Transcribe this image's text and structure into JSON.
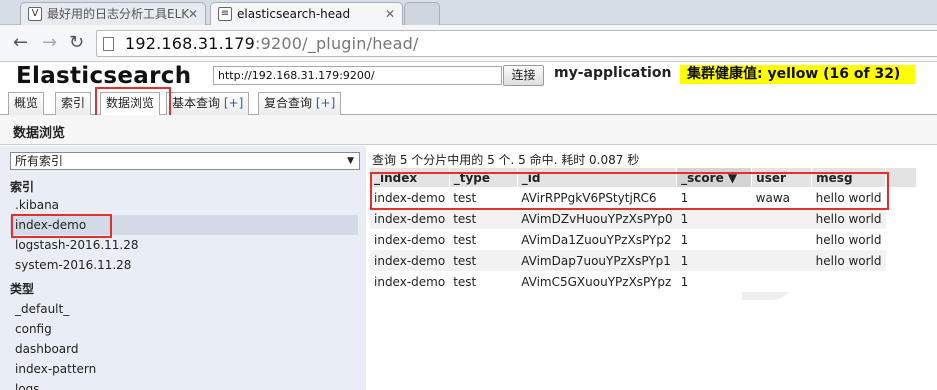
{
  "browser": {
    "tabs": [
      {
        "title": "最好用的日志分析工具ELK"
      },
      {
        "title": "elasticsearch-head"
      }
    ],
    "url_host": "192.168.31.179",
    "url_rest": ":9200/_plugin/head/"
  },
  "app": {
    "title": "Elasticsearch",
    "connect_url": "http://192.168.31.179:9200/",
    "connect_label": "连接",
    "cluster_name": "my-application",
    "health": "集群健康值: yellow (16 of 32)"
  },
  "tabs": {
    "overview": "概览",
    "indices": "索引",
    "browser": "数据浏览",
    "basic_query": "基本查询",
    "complex_query": "复合查询",
    "plus": "[+]"
  },
  "page": {
    "heading": "数据浏览"
  },
  "sidebar": {
    "select_value": "所有索引",
    "indices_label": "索引",
    "indices": [
      ".kibana",
      "index-demo",
      "logstash-2016.11.28",
      "system-2016.11.28"
    ],
    "types_label": "类型",
    "types": [
      "_default_",
      "config",
      "dashboard",
      "index-pattern",
      "logs"
    ]
  },
  "results": {
    "summary": "查询 5 个分片中用的 5 个. 5 命中. 耗时 0.087 秒",
    "columns": [
      "_index",
      "_type",
      "_id",
      "_score ▼",
      "user",
      "mesg"
    ],
    "rows": [
      [
        "index-demo",
        "test",
        "AVirRPPgkV6PStytjRC6",
        "1",
        "wawa",
        "hello world"
      ],
      [
        "index-demo",
        "test",
        "AVimDZvHuouYPzXsPYp0",
        "1",
        "",
        "hello world"
      ],
      [
        "index-demo",
        "test",
        "AVimDa1ZuouYPzXsPYp2",
        "1",
        "",
        "hello world"
      ],
      [
        "index-demo",
        "test",
        "AVimDap7uouYPzXsPYp1",
        "1",
        "",
        "hello world"
      ],
      [
        "index-demo",
        "test",
        "AVimC5GXuouYPzXsPYpz",
        "1",
        "",
        ""
      ]
    ]
  },
  "colors": {
    "highlight": "#e03030",
    "health_bg": "#ffff00",
    "link": "#2a5db0"
  }
}
